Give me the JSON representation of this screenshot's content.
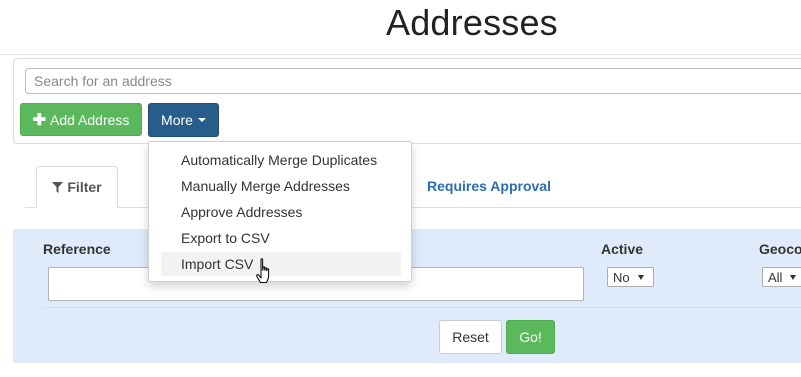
{
  "page": {
    "title": "Addresses"
  },
  "search": {
    "placeholder": "Search for an address"
  },
  "toolbar": {
    "add_label": "Add Address",
    "add_icon": "plus-icon",
    "more_label": "More",
    "more_icon": "caret-down-icon"
  },
  "more_menu": {
    "items": [
      {
        "label": "Automatically Merge Duplicates"
      },
      {
        "label": "Manually Merge Addresses"
      },
      {
        "label": "Approve Addresses"
      },
      {
        "label": "Export to CSV"
      },
      {
        "label": "Import CSV",
        "hovered": true
      }
    ]
  },
  "tabs": {
    "filter_label": "Filter",
    "filter_icon": "filter-icon",
    "approval_label": "Requires Approval"
  },
  "filter": {
    "reference_label": "Reference",
    "reference_value": "",
    "active_label": "Active",
    "active_value": "No",
    "geocode_label": "Geoco",
    "geocode_value": "All",
    "reset_label": "Reset",
    "go_label": "Go!"
  },
  "colors": {
    "add_button": "#5cb85c",
    "more_button": "#275d8b",
    "link": "#2a6fb1",
    "filter_panel": "#dfebfa",
    "go_button": "#5cb85c"
  }
}
